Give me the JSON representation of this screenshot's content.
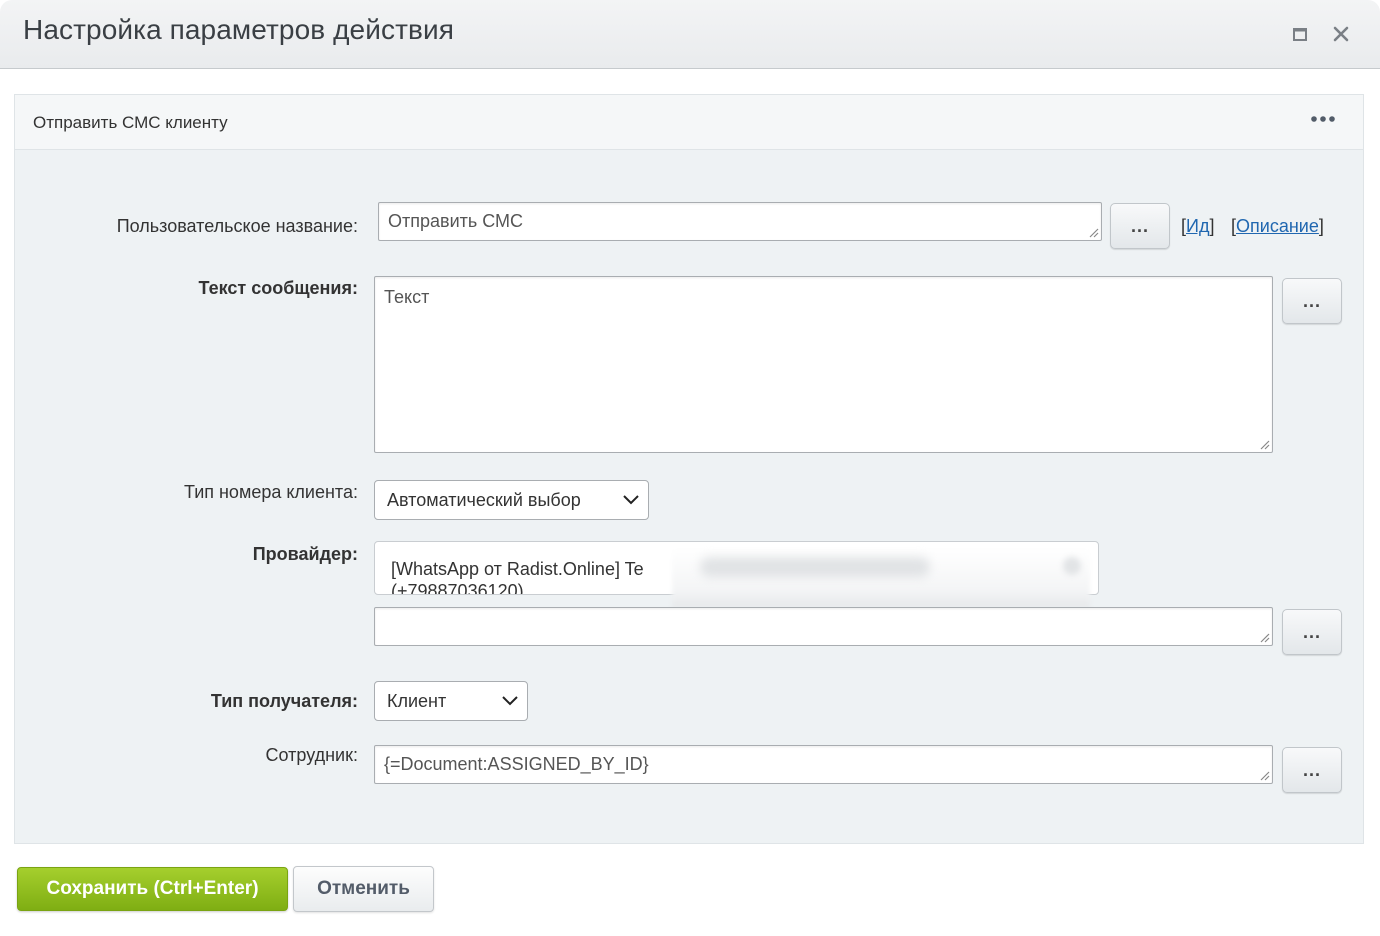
{
  "window": {
    "title": "Настройка параметров действия",
    "maximize_icon": "maximize-icon",
    "close_icon": "close-icon"
  },
  "panel": {
    "title": "Отправить СМС клиенту",
    "menu_icon": "more-horizontal-icon"
  },
  "form": {
    "custom_name": {
      "label": "Пользовательское название:",
      "value": "Отправить СМС",
      "btn": "...",
      "id_link": "Ид",
      "desc_link": "Описание",
      "bracket_open": "[",
      "bracket_close": "]"
    },
    "message_text": {
      "label": "Текст сообщения:",
      "value": "Текст",
      "btn": "..."
    },
    "client_number_type": {
      "label": "Тип номера клиента:",
      "selected": "Автоматический выбор"
    },
    "provider": {
      "label": "Провайдер:",
      "selected_line1": "[WhatsApp от Radist.Online] Te",
      "selected_line2": "(+79887036120)",
      "extra_value": "",
      "btn": "..."
    },
    "recipient_type": {
      "label": "Тип получателя:",
      "selected": "Клиент"
    },
    "employee": {
      "label": "Сотрудник:",
      "value": "{=Document:ASSIGNED_BY_ID}",
      "btn": "..."
    }
  },
  "footer": {
    "save_label": "Сохранить (Ctrl+Enter)",
    "cancel_label": "Отменить"
  },
  "colors": {
    "save_button": "#8fbd1d",
    "link": "#2067b0",
    "panel_bg": "#eef2f4"
  }
}
